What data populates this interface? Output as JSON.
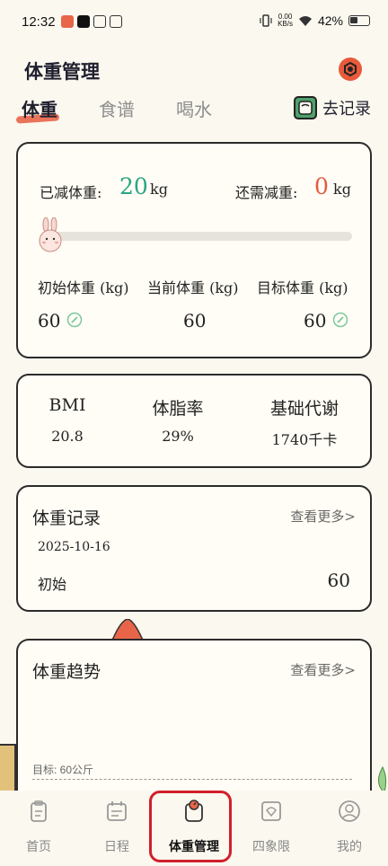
{
  "status": {
    "time": "12:32",
    "net_speed_value": "0.00",
    "net_speed_unit": "KB/s",
    "battery": "42%"
  },
  "header": {
    "title": "体重管理",
    "tabs": [
      "体重",
      "食谱",
      "喝水"
    ],
    "record_label": "去记录"
  },
  "weight": {
    "lost_label": "已减体重:",
    "lost_value": "20",
    "need_label": "还需减重:",
    "need_value": "0",
    "unit": "kg",
    "progress": 0,
    "initial_label": "初始体重 (kg)",
    "current_label": "当前体重 (kg)",
    "target_label": "目标体重 (kg)",
    "initial_value": "60",
    "current_value": "60",
    "target_value": "60"
  },
  "metrics": {
    "bmi_label": "BMI",
    "bmi_value": "20.8",
    "fat_label": "体脂率",
    "fat_value": "29%",
    "bmr_label": "基础代谢",
    "bmr_value": "1740千卡"
  },
  "records": {
    "title": "体重记录",
    "more": "查看更多>",
    "date": "2025-10-16",
    "name": "初始",
    "value": "60"
  },
  "trend": {
    "title": "体重趋势",
    "more": "查看更多>",
    "target_text": "目标: 60公斤"
  },
  "nav": {
    "items": [
      "首页",
      "日程",
      "体重管理",
      "四象限",
      "我的"
    ],
    "active_index": 2
  },
  "colors": {
    "accent_green": "#2aa584",
    "accent_red": "#e55a3e",
    "active_frame": "#d21f2b"
  }
}
